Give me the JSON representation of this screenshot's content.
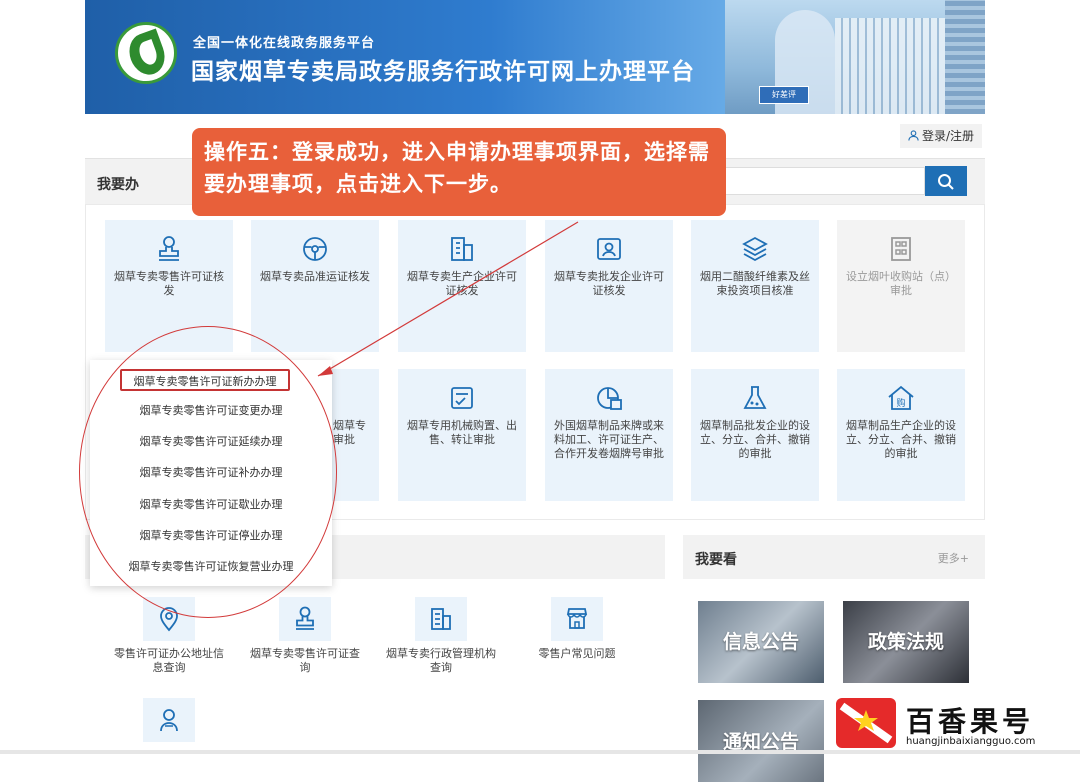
{
  "banner": {
    "subtitle": "全国一体化在线政务服务平台",
    "title": "国家烟草专卖局政务服务行政许可网上办理平台",
    "badge": "好差评"
  },
  "header": {
    "login_label": "登录/注册"
  },
  "woyaoban": {
    "title": "我要办"
  },
  "callout": {
    "text": "操作五：登录成功，进入申请办理事项界面，选择需要办理事项，点击进入下一步。"
  },
  "tiles_row1": [
    {
      "label": "烟草专卖零售许可证核发",
      "icon": "stamp-icon"
    },
    {
      "label": "烟草专卖品准运证核发",
      "icon": "steering-wheel-icon"
    },
    {
      "label": "烟草专卖生产企业许可证核发",
      "icon": "building-icon"
    },
    {
      "label": "烟草专卖批发企业许可证核发",
      "icon": "id-card-icon"
    },
    {
      "label": "烟用二醋酸纤维素及丝束投资项目核准",
      "icon": "layers-icon"
    },
    {
      "label": "设立烟叶收购站（点）审批",
      "icon": "grid-building-icon"
    }
  ],
  "tiles_row2": [
    {
      "label": "烟草专卖品进出口审批",
      "partial_label": "烟草专\n审批"
    },
    {
      "label": "烟草专用机械购置、出售、转让审批",
      "icon": "checklist-icon"
    },
    {
      "label": "外国烟草制品来牌或来料加工、许可证生产、合作开发卷烟牌号审批",
      "icon": "pie-chart-icon"
    },
    {
      "label": "烟草制品批发企业的设立、分立、合并、撤销的审批",
      "icon": "flask-icon"
    },
    {
      "label": "烟草制品生产企业的设立、分立、合并、撤销的审批",
      "icon": "shop-house-icon"
    }
  ],
  "dropdown": {
    "items": [
      "烟草专卖零售许可证新办办理",
      "烟草专卖零售许可证变更办理",
      "烟草专卖零售许可证延续办理",
      "烟草专卖零售许可证补办办理",
      "烟草专卖零售许可证歇业办理",
      "烟草专卖零售许可证停业办理",
      "烟草专卖零售许可证恢复营业办理"
    ]
  },
  "query_tiles": [
    {
      "label": "零售许可证办公地址信息查询",
      "icon": "location-pin-icon"
    },
    {
      "label": "烟草专卖零售许可证查询",
      "icon": "stamp-icon"
    },
    {
      "label": "烟草专卖行政管理机构查询",
      "icon": "building-icon"
    },
    {
      "label": "零售户常见问题",
      "icon": "shop-icon"
    }
  ],
  "woyaokan": {
    "title": "我要看",
    "more": "更多+",
    "cards": [
      "信息公告",
      "政策法规",
      "通知公告"
    ]
  },
  "watermark": {
    "name": "百香果号",
    "url": "huangjinbaixiangguo.com"
  },
  "colors": {
    "primary": "#1f6fb5",
    "callout": "#e8603a",
    "highlight": "#c43434"
  }
}
